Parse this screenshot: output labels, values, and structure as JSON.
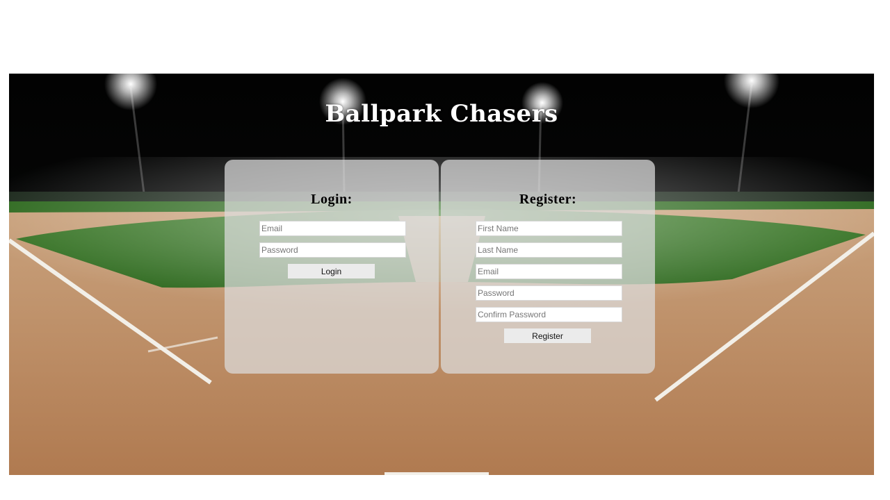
{
  "site": {
    "title": "Ballpark Chasers"
  },
  "login": {
    "heading": "Login:",
    "email_placeholder": "Email",
    "password_placeholder": "Password",
    "submit_label": "Login"
  },
  "register": {
    "heading": "Register:",
    "first_name_placeholder": "First Name",
    "last_name_placeholder": "Last Name",
    "email_placeholder": "Email",
    "password_placeholder": "Password",
    "confirm_password_placeholder": "Confirm Password",
    "submit_label": "Register"
  },
  "colors": {
    "panel_bg": "#dcdcdc",
    "button_bg": "#ebebeb",
    "title_text": "#ffffff"
  }
}
